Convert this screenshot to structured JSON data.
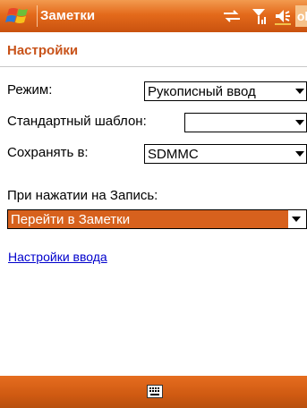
{
  "app": {
    "title": "Заметки",
    "ok_label": "ok"
  },
  "page": {
    "title": "Настройки"
  },
  "form": {
    "mode_label": "Режим:",
    "mode_value": "Рукописный ввод",
    "template_label": "Стандартный шаблон:",
    "template_value": "",
    "save_label": "Сохранять в:",
    "save_value": "SDMMC",
    "press_label": "При нажатии на Запись:",
    "press_value": "Перейти в Заметки"
  },
  "links": {
    "input_settings": "Настройки ввода"
  },
  "colors": {
    "accent": "#d7611d",
    "link": "#0000cc"
  },
  "icons": [
    "windows-start-icon",
    "network-icon",
    "signal-icon",
    "volume-icon",
    "keyboard-icon"
  ]
}
